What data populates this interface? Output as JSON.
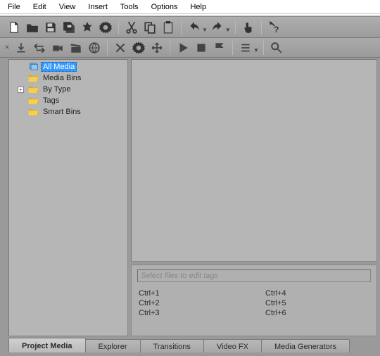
{
  "menubar": [
    "File",
    "Edit",
    "View",
    "Insert",
    "Tools",
    "Options",
    "Help"
  ],
  "main_toolbar": [
    {
      "name": "new-doc-icon",
      "title": "New"
    },
    {
      "name": "open-folder-icon",
      "title": "Open"
    },
    {
      "name": "save-icon",
      "title": "Save"
    },
    {
      "name": "save-as-icon",
      "title": "Save As"
    },
    {
      "name": "render-icon",
      "title": "Render"
    },
    {
      "name": "properties-icon",
      "title": "Properties"
    },
    {
      "sep": true
    },
    {
      "name": "cut-icon",
      "title": "Cut"
    },
    {
      "name": "copy-icon",
      "title": "Copy"
    },
    {
      "name": "paste-icon",
      "title": "Paste"
    },
    {
      "sep": true
    },
    {
      "name": "undo-icon",
      "title": "Undo",
      "drop": true
    },
    {
      "name": "redo-icon",
      "title": "Redo",
      "drop": true
    },
    {
      "sep": true
    },
    {
      "name": "touch-icon",
      "title": "Interactive"
    },
    {
      "sep": true
    },
    {
      "name": "help-icon",
      "title": "Help"
    }
  ],
  "sub_toolbar": [
    {
      "name": "import-icon"
    },
    {
      "name": "capture-arrow-icon"
    },
    {
      "name": "capture-video-icon"
    },
    {
      "name": "capture-clap-icon"
    },
    {
      "name": "get-web-icon"
    },
    {
      "sep": true
    },
    {
      "name": "remove-icon"
    },
    {
      "name": "media-fx-icon"
    },
    {
      "name": "media-props-icon"
    },
    {
      "sep": true
    },
    {
      "name": "play-icon"
    },
    {
      "name": "stop-icon"
    },
    {
      "name": "auto-preview-icon"
    },
    {
      "sep": true
    },
    {
      "name": "views-icon",
      "drop": true
    },
    {
      "sep": true
    },
    {
      "name": "search-icon"
    }
  ],
  "tree": [
    {
      "id": "all-media",
      "label": "All Media",
      "icon": "stack",
      "selected": true,
      "expandable": false
    },
    {
      "id": "media-bins",
      "label": "Media Bins",
      "icon": "folder",
      "expandable": false
    },
    {
      "id": "by-type",
      "label": "By Type",
      "icon": "folder",
      "expandable": true
    },
    {
      "id": "tags",
      "label": "Tags",
      "icon": "folder",
      "expandable": false
    },
    {
      "id": "smart-bins",
      "label": "Smart Bins",
      "icon": "folder",
      "expandable": false
    }
  ],
  "tags_placeholder": "Select files to edit tags",
  "shortcuts": {
    "left": [
      "Ctrl+1",
      "Ctrl+2",
      "Ctrl+3"
    ],
    "right": [
      "Ctrl+4",
      "Ctrl+5",
      "Ctrl+6"
    ]
  },
  "tabs": [
    {
      "id": "project-media",
      "label": "Project Media",
      "active": true
    },
    {
      "id": "explorer",
      "label": "Explorer"
    },
    {
      "id": "transitions",
      "label": "Transitions"
    },
    {
      "id": "video-fx",
      "label": "Video FX"
    },
    {
      "id": "media-generators",
      "label": "Media Generators"
    }
  ],
  "colors": {
    "accent": "#3399ff",
    "folder": "#f5cf52"
  }
}
